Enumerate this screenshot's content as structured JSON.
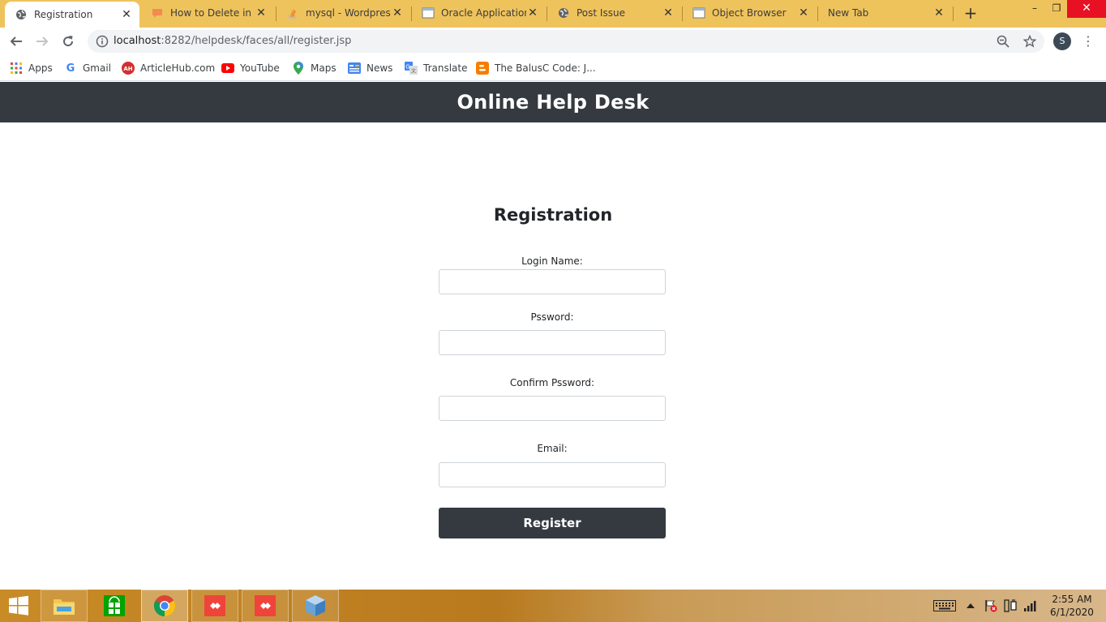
{
  "browser": {
    "tabs": [
      {
        "title": "Registration",
        "icon": "globe-icon",
        "active": true
      },
      {
        "title": "How to Delete in M",
        "icon": "chat-bubble-icon",
        "active": false
      },
      {
        "title": "mysql - Wordpress",
        "icon": "stackoverflow-icon",
        "active": false
      },
      {
        "title": "Oracle Application",
        "icon": "window-page-icon",
        "active": false
      },
      {
        "title": "Post Issue",
        "icon": "globe-icon",
        "active": false
      },
      {
        "title": "Object Browser",
        "icon": "window-page-icon",
        "active": false
      },
      {
        "title": "New Tab",
        "icon": "",
        "active": false
      }
    ],
    "new_tab_label": "+",
    "window_controls": {
      "minimize": "–",
      "maximize": "❐",
      "close": "✕"
    },
    "address": {
      "host": "localhost",
      "rest": ":8282/helpdesk/faces/all/register.jsp"
    },
    "profile_initial": "S",
    "menu_label": "⋮",
    "bookmarks": [
      {
        "label": "Apps",
        "icon": "apps-grid-icon"
      },
      {
        "label": "Gmail",
        "icon": "google-icon"
      },
      {
        "label": "ArticleHub.com",
        "icon": "articlehub-icon"
      },
      {
        "label": "YouTube",
        "icon": "youtube-icon"
      },
      {
        "label": "Maps",
        "icon": "maps-pin-icon"
      },
      {
        "label": "News",
        "icon": "news-icon"
      },
      {
        "label": "Translate",
        "icon": "translate-icon"
      },
      {
        "label": "The BalusC Code: J...",
        "icon": "blogger-icon"
      }
    ]
  },
  "page": {
    "site_title": "Online Help Desk",
    "form_title": "Registration",
    "fields": [
      {
        "label": "Login Name:",
        "value": "",
        "type": "text"
      },
      {
        "label": "Pssword:",
        "value": "",
        "type": "password"
      },
      {
        "label": "Confirm Pssword:",
        "value": "",
        "type": "password"
      },
      {
        "label": "Email:",
        "value": "",
        "type": "email"
      }
    ],
    "submit_label": "Register",
    "colors": {
      "header_bg": "#343a40",
      "button_bg": "#343a40",
      "tabstrip": "#efc35c",
      "close_red": "#e81123"
    }
  },
  "taskbar": {
    "items": [
      {
        "name": "start-button",
        "icon": "windows-logo-icon"
      },
      {
        "name": "file-explorer",
        "icon": "folder-icon"
      },
      {
        "name": "store",
        "icon": "store-icon"
      },
      {
        "name": "chrome",
        "icon": "chrome-icon"
      },
      {
        "name": "anydesk-1",
        "icon": "anydesk-icon"
      },
      {
        "name": "anydesk-2",
        "icon": "anydesk-icon"
      },
      {
        "name": "virtualbox",
        "icon": "cube-icon"
      }
    ],
    "tray_icons": [
      "keyboard-icon",
      "chevron-up-icon",
      "action-center-flag-icon",
      "power-plug-icon",
      "signal-bars-icon"
    ],
    "time": "2:55 AM",
    "date": "6/1/2020"
  }
}
